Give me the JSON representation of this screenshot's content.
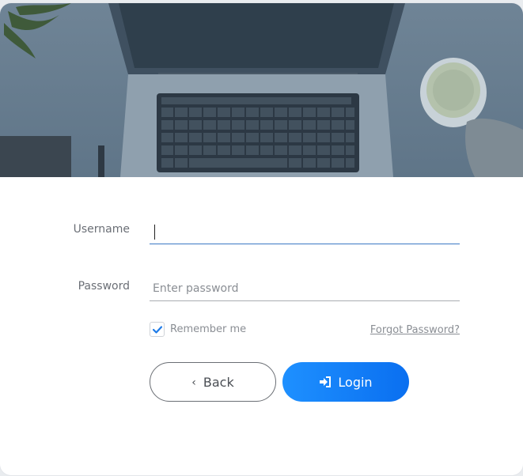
{
  "form": {
    "username_label": "Username",
    "username_value": "",
    "password_label": "Password",
    "password_placeholder": "Enter password",
    "remember_label": "Remember me",
    "remember_checked": true,
    "forgot_label": "Forgot Password?"
  },
  "buttons": {
    "back_label": "Back",
    "back_icon": "chevron-left-icon",
    "login_label": "Login",
    "login_icon": "sign-in-icon"
  },
  "colors": {
    "accent": "#1e90ff",
    "hero_tint": "#3e5467"
  }
}
